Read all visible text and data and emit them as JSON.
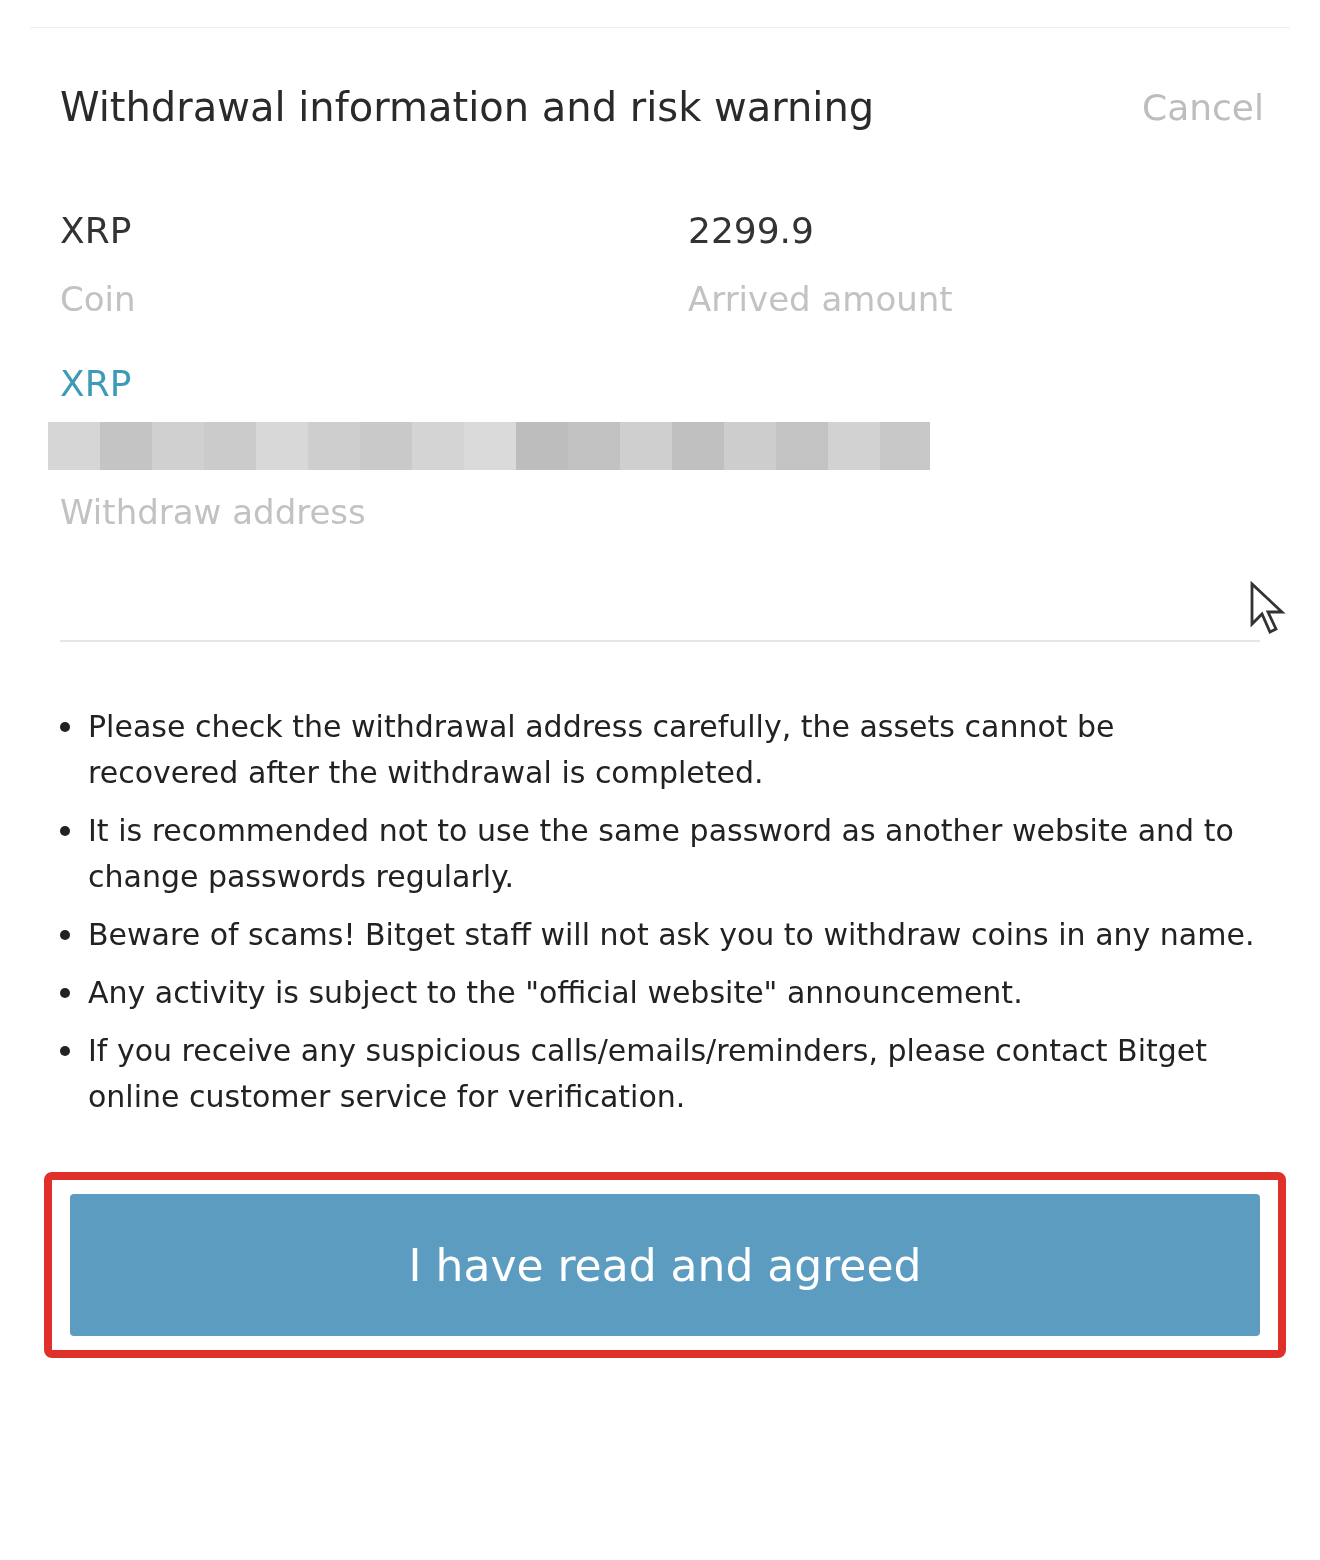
{
  "header": {
    "title": "Withdrawal information and risk warning",
    "cancel": "Cancel"
  },
  "summary": [
    {
      "value": "XRP",
      "label": "Coin"
    },
    {
      "value": "2299.9",
      "label": "Arrived amount"
    }
  ],
  "address": {
    "network": "XRP",
    "label": "Withdraw address"
  },
  "notes": [
    "Please check the withdrawal address carefully, the assets cannot be recovered after the withdrawal is completed.",
    "It is recommended not to use the same password as another website and to change passwords regularly.",
    "Beware of scams! Bitget staff will not ask you to withdraw coins in any name.",
    "Any activity is subject to the \"official website\" announcement.",
    "If you receive any suspicious calls/emails/reminders, please contact Bitget online customer service for verification."
  ],
  "confirm": {
    "label": "I have read and agreed",
    "highlighted": true
  }
}
